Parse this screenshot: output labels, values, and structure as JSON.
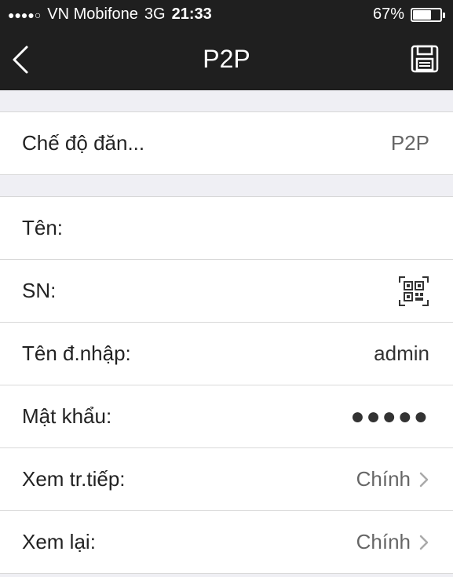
{
  "status": {
    "signal_dots": "●●●●○",
    "carrier": "VN Mobifone",
    "network": "3G",
    "time": "21:33",
    "battery_percent_text": "67%",
    "battery_level": 0.67
  },
  "header": {
    "title": "P2P",
    "back_icon": "chevron-left-icon",
    "save_icon": "floppy-disk-icon"
  },
  "mode_row": {
    "label": "Chế độ đăn...",
    "value": "P2P"
  },
  "fields": {
    "name": {
      "label": "Tên:",
      "value": ""
    },
    "sn": {
      "label": "SN:",
      "icon": "qr-scan-icon"
    },
    "username": {
      "label": "Tên đ.nhập:",
      "value": "admin"
    },
    "password": {
      "label": "Mật khẩu:",
      "value": "●●●●●"
    },
    "live_view": {
      "label": "Xem tr.tiếp:",
      "value": "Chính"
    },
    "playback": {
      "label": "Xem lại:",
      "value": "Chính"
    }
  },
  "colors": {
    "topbar": "#1f1f1f",
    "background": "#efeff4"
  }
}
